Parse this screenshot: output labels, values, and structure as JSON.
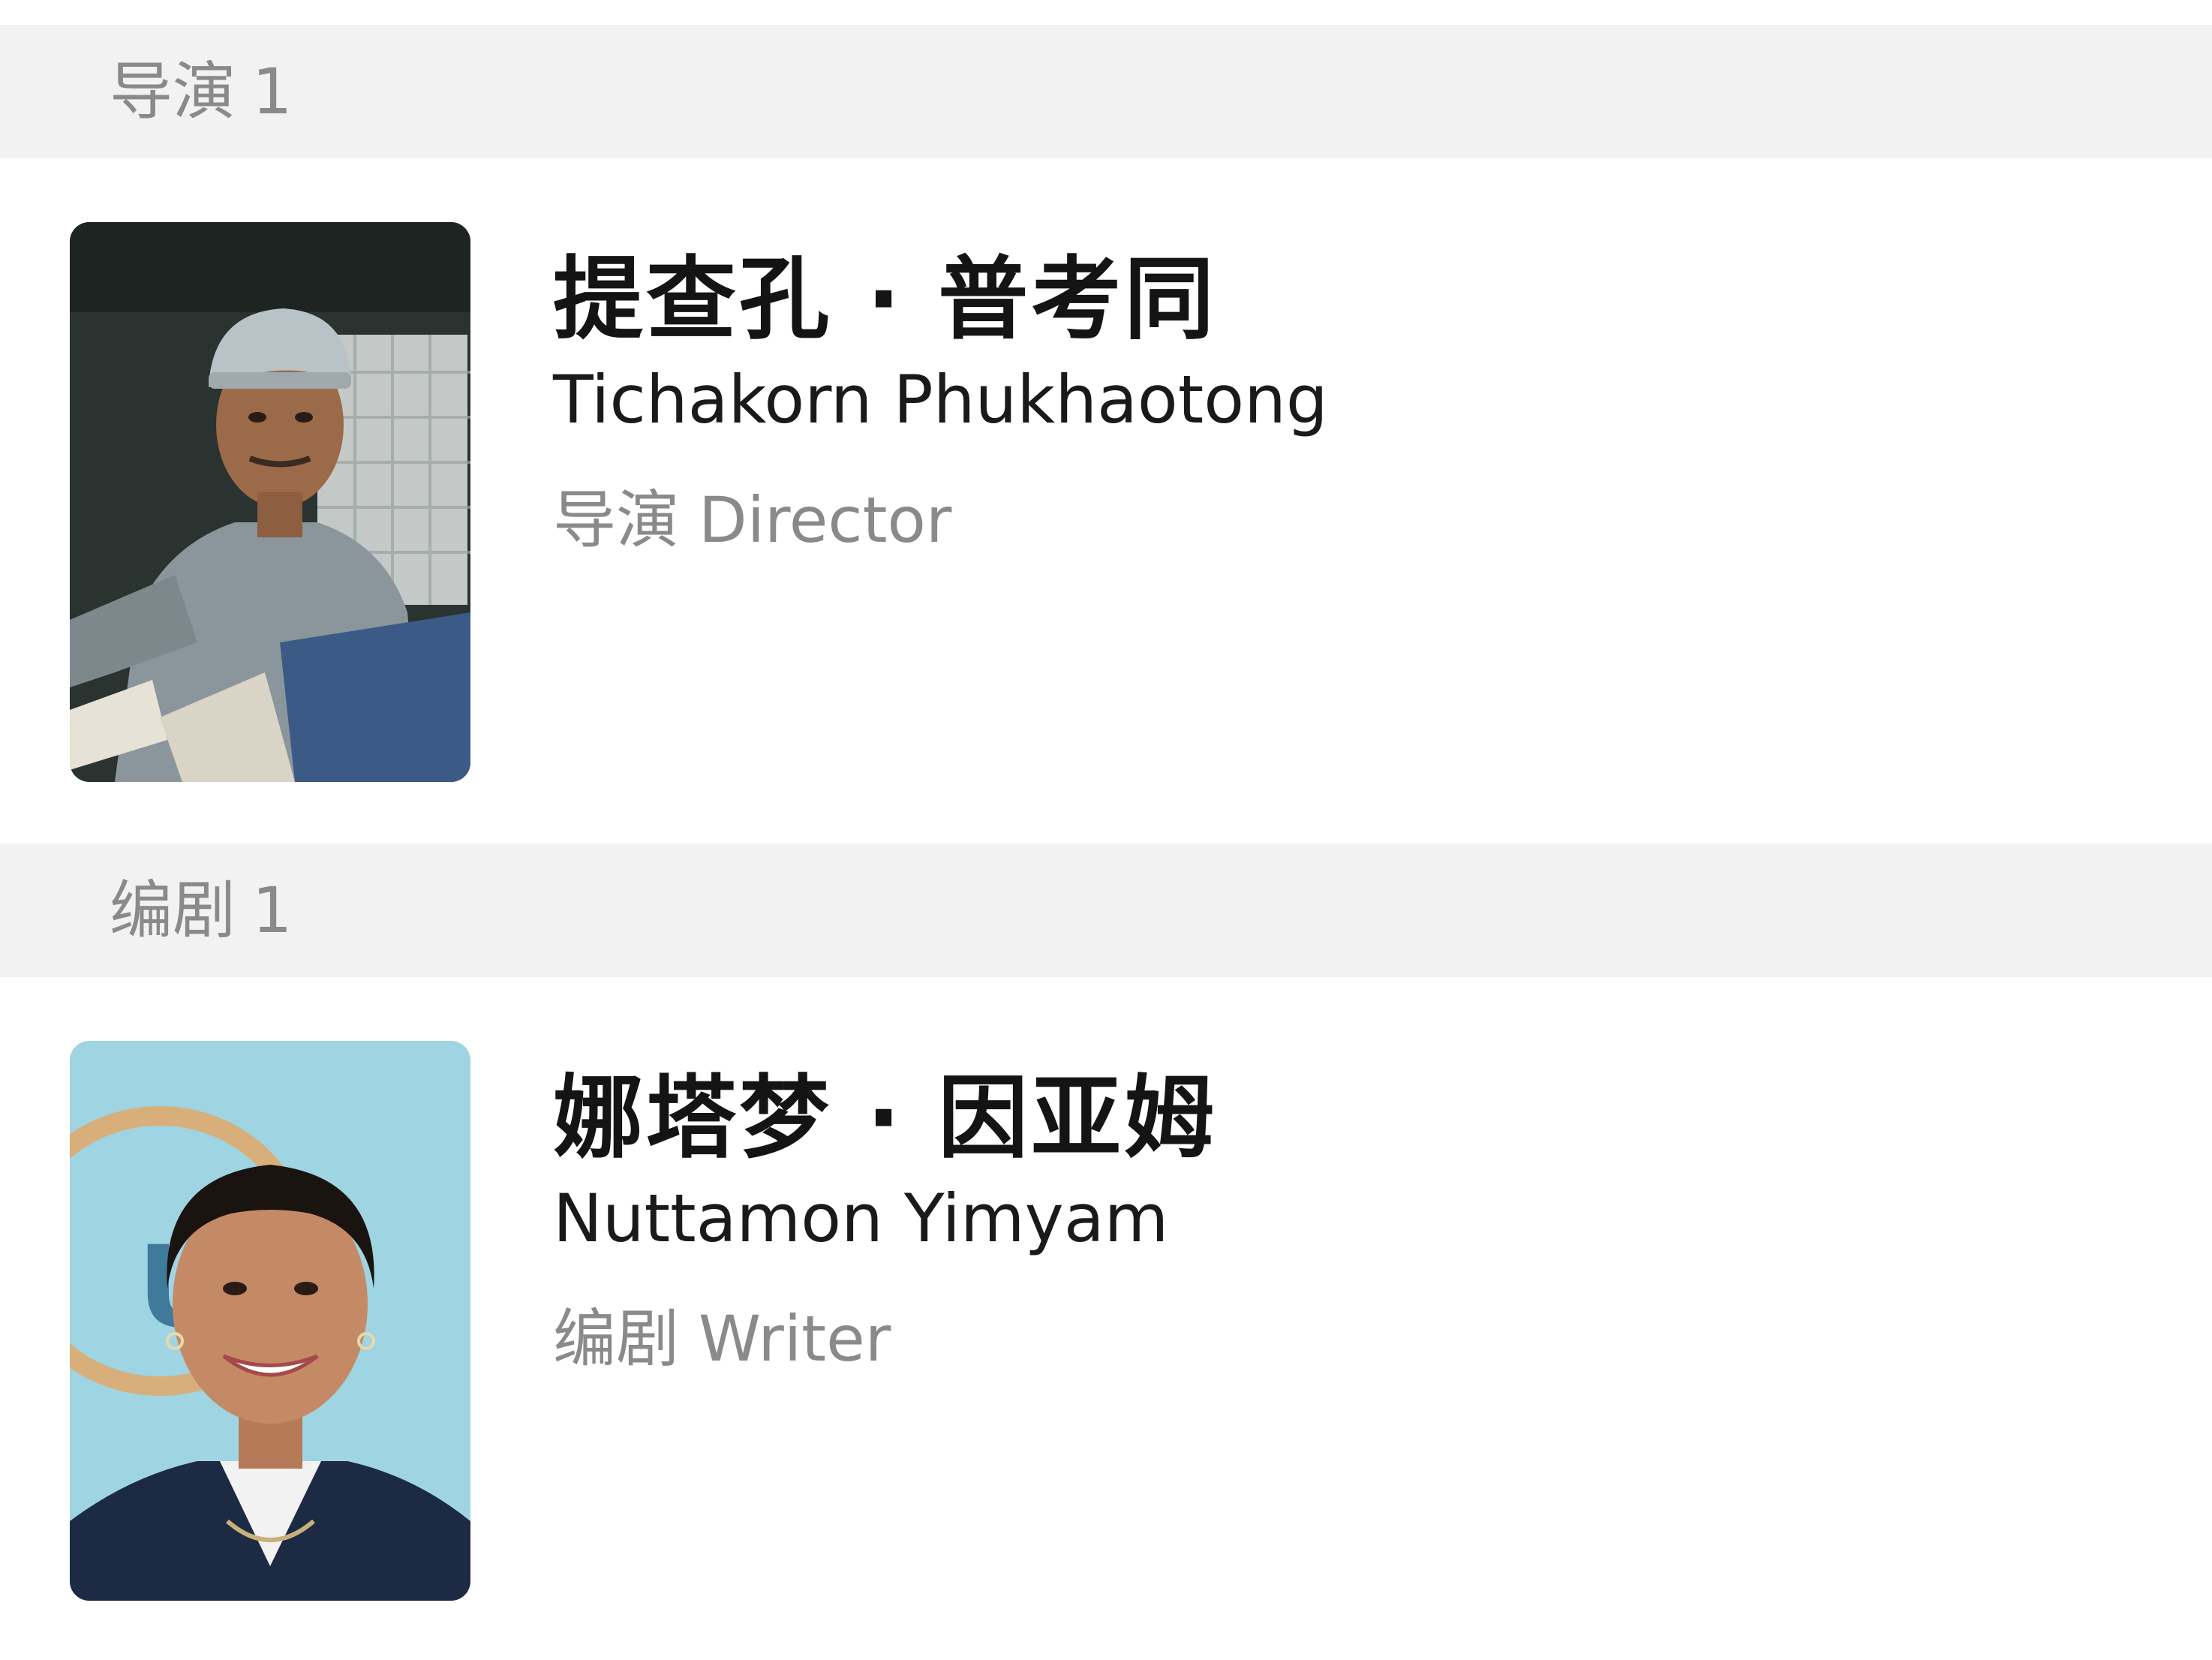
{
  "sections": [
    {
      "header": {
        "title": "导演",
        "count": "1"
      },
      "person": {
        "name_cn": "提查孔 · 普考同",
        "name_en": "Tichakorn Phukhaotong",
        "role_cn": "导演",
        "role_en": "Director"
      }
    },
    {
      "header": {
        "title": "编剧",
        "count": "1"
      },
      "person": {
        "name_cn": "娜塔梦 · 因亚姆",
        "name_en": "Nuttamon Yimyam",
        "role_cn": "编剧",
        "role_en": "Writer"
      }
    }
  ]
}
